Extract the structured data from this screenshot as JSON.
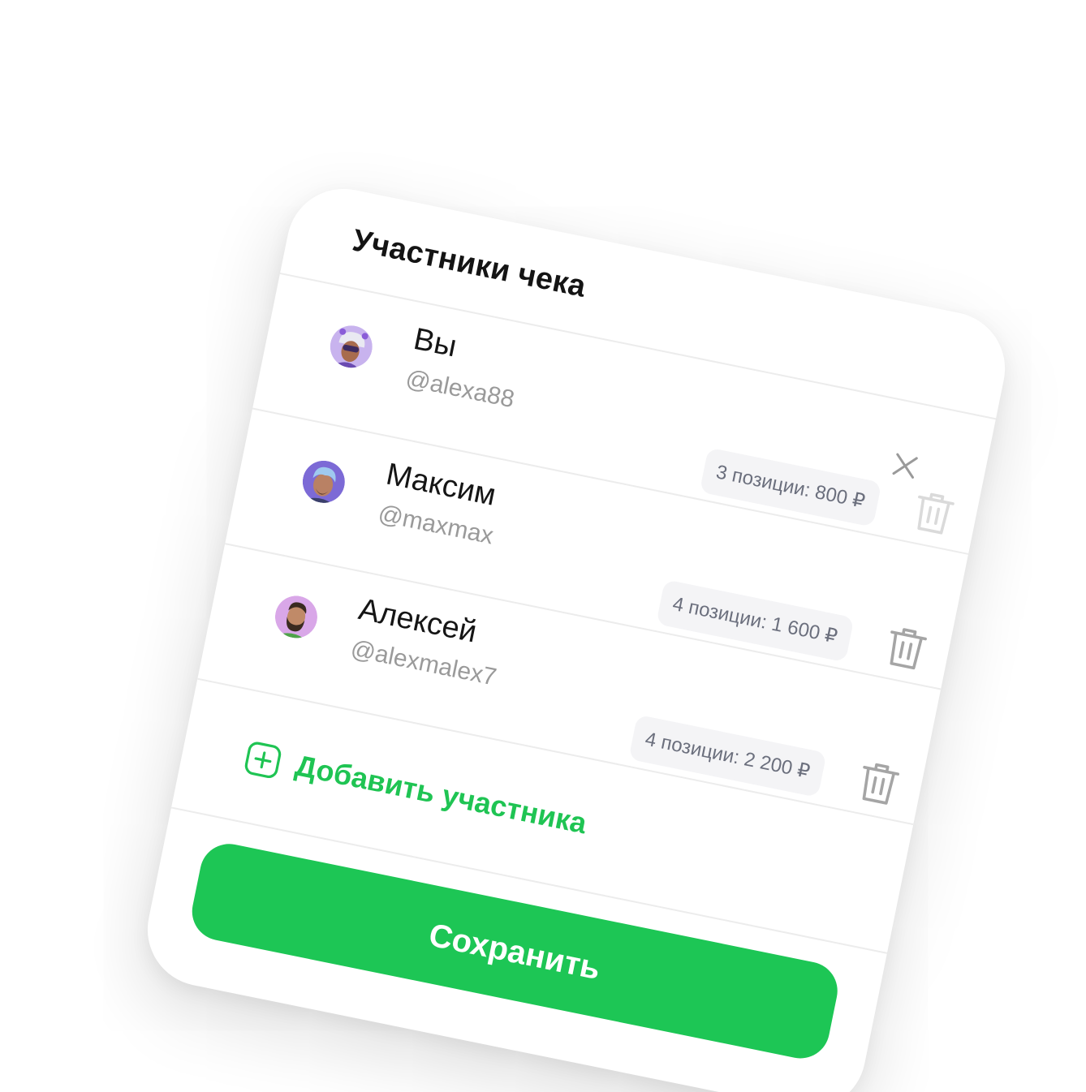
{
  "dialog": {
    "title": "Участники чека",
    "close_icon": "close-icon"
  },
  "participants": [
    {
      "name": "Вы",
      "handle": "@alexa88",
      "badge": "3 позиции: 800 ₽",
      "avatar": "avatar-girl-headphones",
      "delete_icon": "trash-icon",
      "delete_disabled": true
    },
    {
      "name": "Максим",
      "handle": "@maxmax",
      "badge": "4 позиции: 1 600 ₽",
      "avatar": "avatar-man-blue-hair",
      "delete_icon": "trash-icon",
      "delete_disabled": false
    },
    {
      "name": "Алексей",
      "handle": "@alexmalex7",
      "badge": "4 позиции: 2 200 ₽",
      "avatar": "avatar-man-beard",
      "delete_icon": "trash-icon",
      "delete_disabled": false
    }
  ],
  "add_participant": {
    "label": "Добавить участника",
    "icon": "plus-square-icon"
  },
  "save_button": {
    "label": "Сохранить"
  },
  "colors": {
    "accent_green": "#1DC655",
    "add_text_green": "#1FC453",
    "badge_bg": "#F4F4F6",
    "badge_text": "#6B6F7D",
    "handle_text": "#9A9A9A",
    "trash_active": "#A5A5A5",
    "trash_disabled": "#DADADA"
  }
}
